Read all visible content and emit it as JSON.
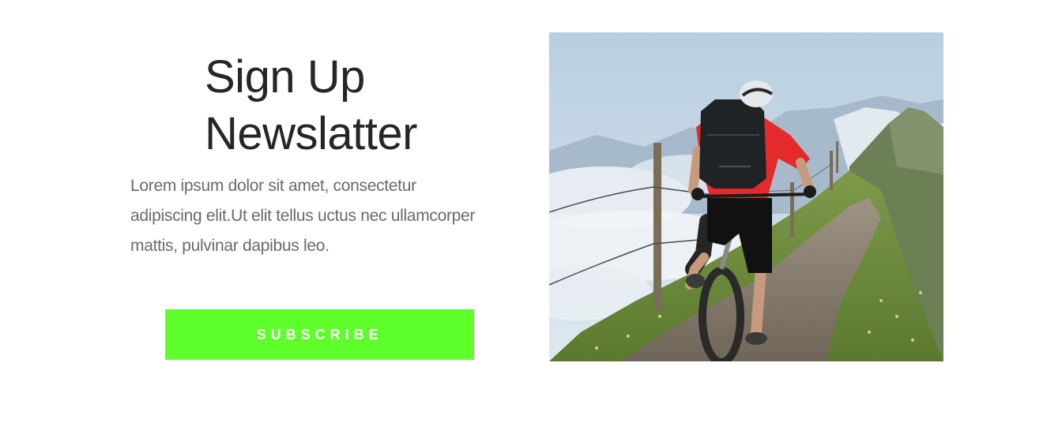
{
  "newsletter": {
    "title_line1": "Sign Up",
    "title_line2": "Newslatter",
    "body_line1": "Lorem ipsum dolor sit amet, consectetur",
    "body_line2": "adipiscing elit.Ut elit tellus uctus nec ullamcorper",
    "body_line3": "mattis, pulvinar dapibus leo.",
    "subscribe_label": "SUBSCRIBE"
  },
  "colors": {
    "button": "#5eff2b",
    "title": "#262626",
    "body": "#6a6a6a"
  }
}
